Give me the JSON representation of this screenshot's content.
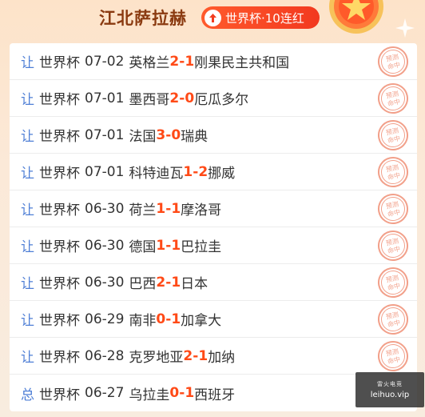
{
  "header": {
    "title": "江北萨拉赫",
    "streak": "世界杯·10连红"
  },
  "matches": [
    {
      "tag": "让",
      "comp": "世界杯",
      "date": "07-02",
      "home": "英格兰",
      "hs": "2",
      "sep": " - ",
      "as": "1",
      "away": "刚果民主共和国",
      "stamp": "预测命中"
    },
    {
      "tag": "让",
      "comp": "世界杯",
      "date": "07-01",
      "home": "墨西哥",
      "hs": "2",
      "sep": " - ",
      "as": "0",
      "away": "厄瓜多尔",
      "stamp": "预测命中"
    },
    {
      "tag": "让",
      "comp": "世界杯",
      "date": "07-01",
      "home": "法国",
      "hs": "3",
      "sep": " - ",
      "as": "0",
      "away": "瑞典",
      "stamp": "预测命中"
    },
    {
      "tag": "让",
      "comp": "世界杯",
      "date": "07-01",
      "home": "科特迪瓦",
      "hs": "1",
      "sep": " - ",
      "as": "2",
      "away": "挪威",
      "stamp": "预测命中"
    },
    {
      "tag": "让",
      "comp": "世界杯",
      "date": "06-30",
      "home": "荷兰",
      "hs": "1",
      "sep": " - ",
      "as": "1",
      "away": "摩洛哥",
      "stamp": "预测命中"
    },
    {
      "tag": "让",
      "comp": "世界杯",
      "date": "06-30",
      "home": "德国",
      "hs": "1",
      "sep": " - ",
      "as": "1",
      "away": "巴拉圭",
      "stamp": "预测命中"
    },
    {
      "tag": "让",
      "comp": "世界杯",
      "date": "06-30",
      "home": "巴西",
      "hs": "2",
      "sep": " - ",
      "as": "1",
      "away": "日本",
      "stamp": "预测命中"
    },
    {
      "tag": "让",
      "comp": "世界杯",
      "date": "06-29",
      "home": "南非",
      "hs": "0",
      "sep": " - ",
      "as": "1",
      "away": "加拿大",
      "stamp": "预测命中"
    },
    {
      "tag": "让",
      "comp": "世界杯",
      "date": "06-28",
      "home": "克罗地亚",
      "hs": "2",
      "sep": " - ",
      "as": "1",
      "away": "加纳",
      "stamp": "预测命中"
    },
    {
      "tag": "总",
      "comp": "世界杯",
      "date": "06-27",
      "home": "乌拉圭",
      "hs": "0",
      "sep": " - ",
      "as": "1",
      "away": "西班牙",
      "stamp": ""
    }
  ],
  "watermark": {
    "line1": "雷火电竞",
    "line2": "leihuo.vip"
  },
  "colors": {
    "score": "#ff4a17",
    "tag": "#4f7fd6",
    "title": "#8a3a10",
    "stamp": "#f2a08a"
  }
}
